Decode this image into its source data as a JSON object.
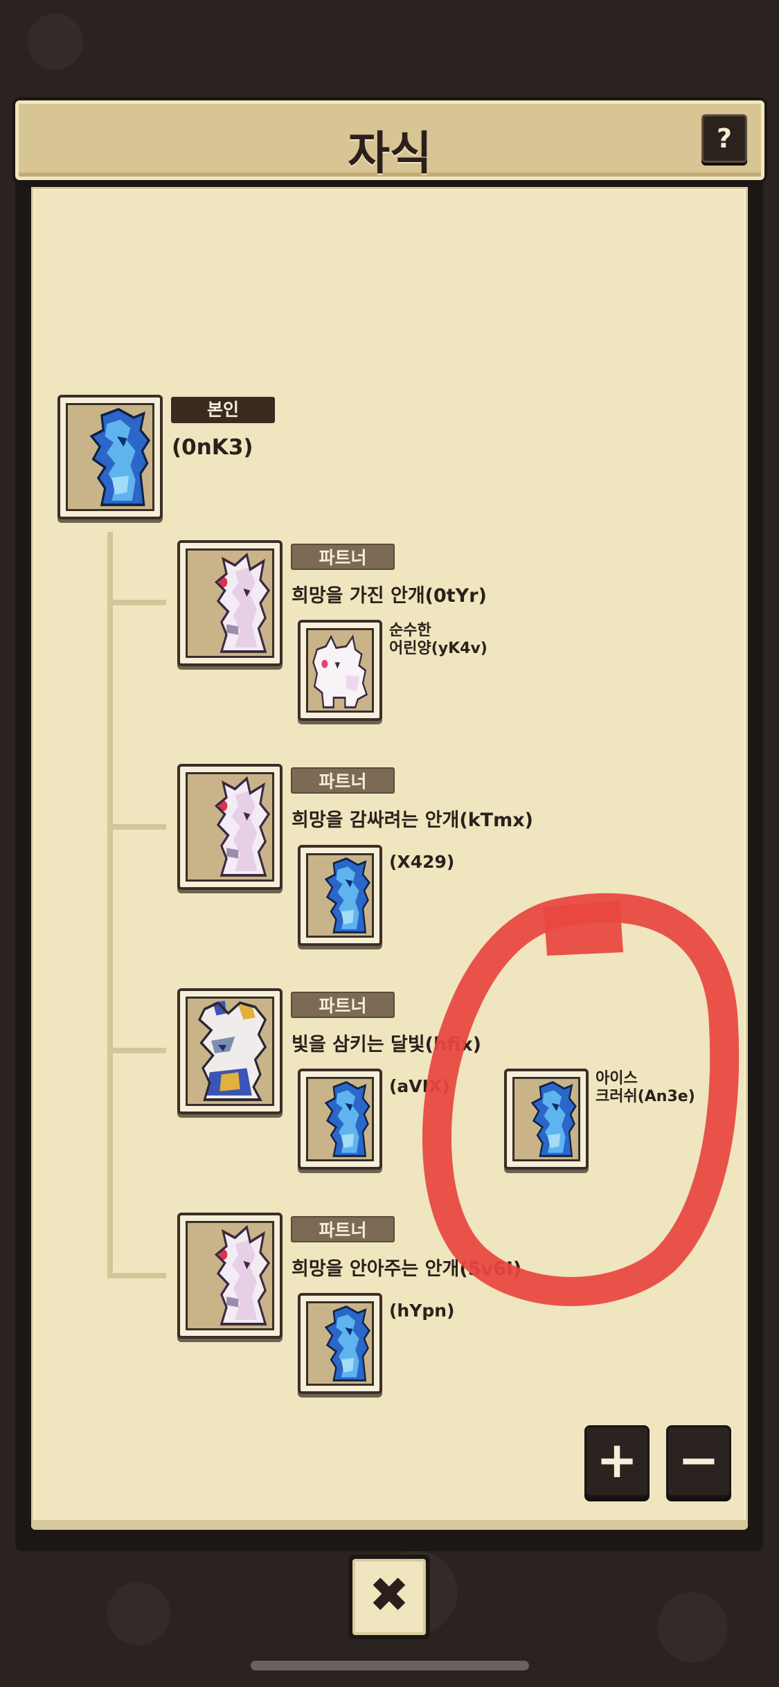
{
  "header": {
    "title": "자식",
    "help_label": "?"
  },
  "self": {
    "badge": "본인",
    "name": "(0nK3)",
    "portrait_icon": "blue-dragon-icon"
  },
  "partners": [
    {
      "badge": "파트너",
      "name": "희망을 가진 안개(0tYr)",
      "portrait_icon": "white-dragon-icon",
      "children": [
        {
          "name": "순수한\n어린양(yK4v)",
          "portrait_icon": "white-lamb-icon"
        }
      ]
    },
    {
      "badge": "파트너",
      "name": "희망을 감싸려는 안개(kTmx)",
      "portrait_icon": "white-dragon-icon",
      "children": [
        {
          "name": "(X429)",
          "portrait_icon": "blue-dragon-icon"
        }
      ]
    },
    {
      "badge": "파트너",
      "name": "빛을 삼키는 달빛(hfix)",
      "portrait_icon": "moon-dragon-icon",
      "children": [
        {
          "name": "(aVIX)",
          "portrait_icon": "blue-dragon-icon"
        },
        {
          "name": "아이스\n크러쉬(An3e)",
          "portrait_icon": "blue-dragon-icon"
        }
      ]
    },
    {
      "badge": "파트너",
      "name": "희망을 안아주는 안개(5v6I)",
      "portrait_icon": "white-dragon-icon",
      "children": [
        {
          "name": "(hYpn)",
          "portrait_icon": "blue-dragon-icon"
        }
      ]
    }
  ],
  "controls": {
    "zoom_in": "+",
    "zoom_out": "−",
    "close": "✖"
  },
  "colors": {
    "paper": "#efe5bf",
    "frame": "#1c1715",
    "annotation": "#e8473f"
  }
}
